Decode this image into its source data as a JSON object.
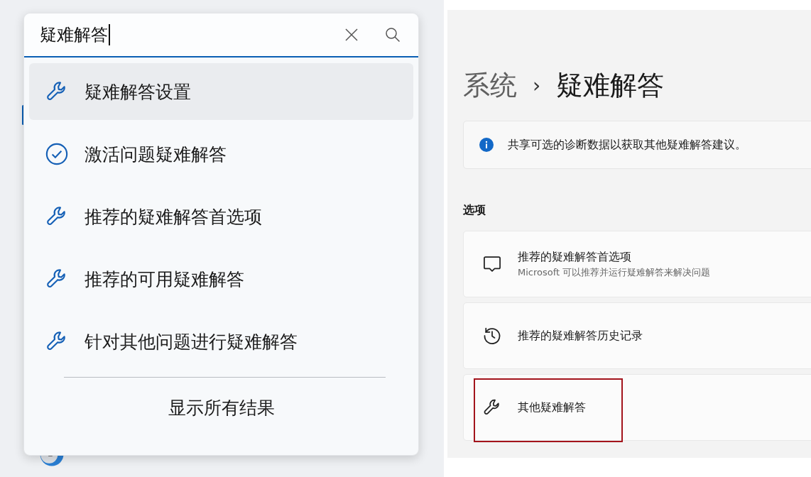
{
  "search": {
    "value": "疑难解答",
    "focused": true
  },
  "results": [
    {
      "label": "疑难解答设置",
      "kind": "wrench",
      "selected": true
    },
    {
      "label": "激活问题疑难解答",
      "kind": "check",
      "selected": false
    },
    {
      "label": "推荐的疑难解答首选项",
      "kind": "wrench",
      "selected": false
    },
    {
      "label": "推荐的可用疑难解答",
      "kind": "wrench",
      "selected": false
    },
    {
      "label": "针对其他问题进行疑难解答",
      "kind": "wrench",
      "selected": false
    }
  ],
  "show_all": "显示所有结果",
  "settings": {
    "breadcrumb": [
      "系统",
      "疑难解答"
    ],
    "separator": "›",
    "info": "共享可选的诊断数据以获取其他疑难解答建议。",
    "section": "选项",
    "options": [
      {
        "kind": "chat",
        "title": "推荐的疑难解答首选项",
        "subtitle": "Microsoft 可以推荐并运行疑难解答来解决问题",
        "highlighted": false
      },
      {
        "kind": "history",
        "title": "推荐的疑难解答历史记录",
        "highlighted": false
      },
      {
        "kind": "wrench",
        "title": "其他疑难解答",
        "highlighted": true
      }
    ]
  }
}
